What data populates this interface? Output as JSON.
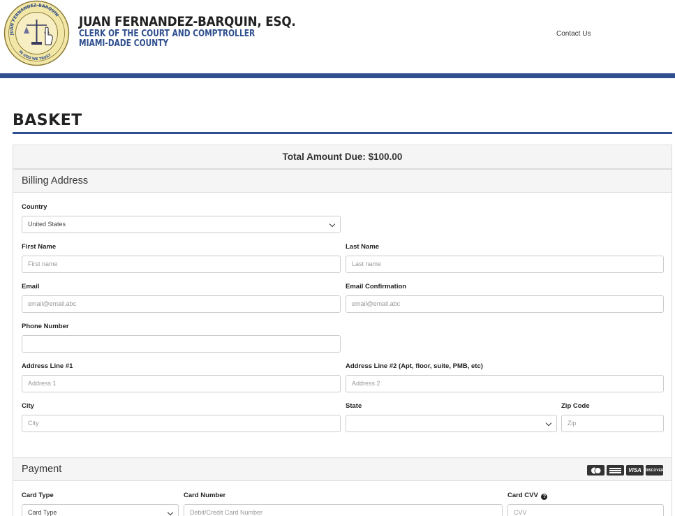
{
  "header": {
    "seal_ring_top": "JUAN FERNANDEZ-BARQUIN",
    "seal_ring_left": "CLERK OF THE COURT & COMPTROLLER",
    "seal_ring_bottom": "IN GOD WE TRUST",
    "seal_county": "MIAMI-DADE COUNTY, FLORIDA",
    "name": "JUAN FERNANDEZ-BARQUIN, ESQ.",
    "subtitle1": "CLERK OF THE COURT AND COMPTROLLER",
    "subtitle2": "MIAMI-DADE COUNTY",
    "contact_link": "Contact Us"
  },
  "page": {
    "title": "BASKET",
    "total_due": "Total Amount Due: $100.00"
  },
  "billing": {
    "section_title": "Billing Address",
    "country_label": "Country",
    "country_value": "United States",
    "first_name_label": "First Name",
    "first_name_placeholder": "First name",
    "last_name_label": "Last Name",
    "last_name_placeholder": "Last name",
    "email_label": "Email",
    "email_placeholder": "email@email.abc",
    "email_confirm_label": "Email Confirmation",
    "email_confirm_placeholder": "email@email.abc",
    "phone_label": "Phone Number",
    "phone_placeholder": "",
    "address1_label": "Address Line #1",
    "address1_placeholder": "Address 1",
    "address2_label": "Address Line #2 (Apt, floor, suite, PMB, etc)",
    "address2_placeholder": "Address 2",
    "city_label": "City",
    "city_placeholder": "City",
    "state_label": "State",
    "state_value": "",
    "zip_label": "Zip Code",
    "zip_placeholder": "Zip"
  },
  "payment": {
    "section_title": "Payment",
    "card_icons": [
      "mastercard-icon",
      "amex-icon",
      "visa-icon",
      "discover-icon"
    ],
    "visa_text": "VISA",
    "discover_text": "DISCOVER",
    "card_type_label": "Card Type",
    "card_type_value": "Card Type",
    "card_number_label": "Card Number",
    "card_number_placeholder": "Debit/Credit Card Number",
    "cvv_label": "Card CVV",
    "cvv_placeholder": "CVV"
  },
  "colors": {
    "brand_blue": "#2f4f8f",
    "panel_header_bg": "#f5f5f5",
    "border": "#dddddd"
  }
}
